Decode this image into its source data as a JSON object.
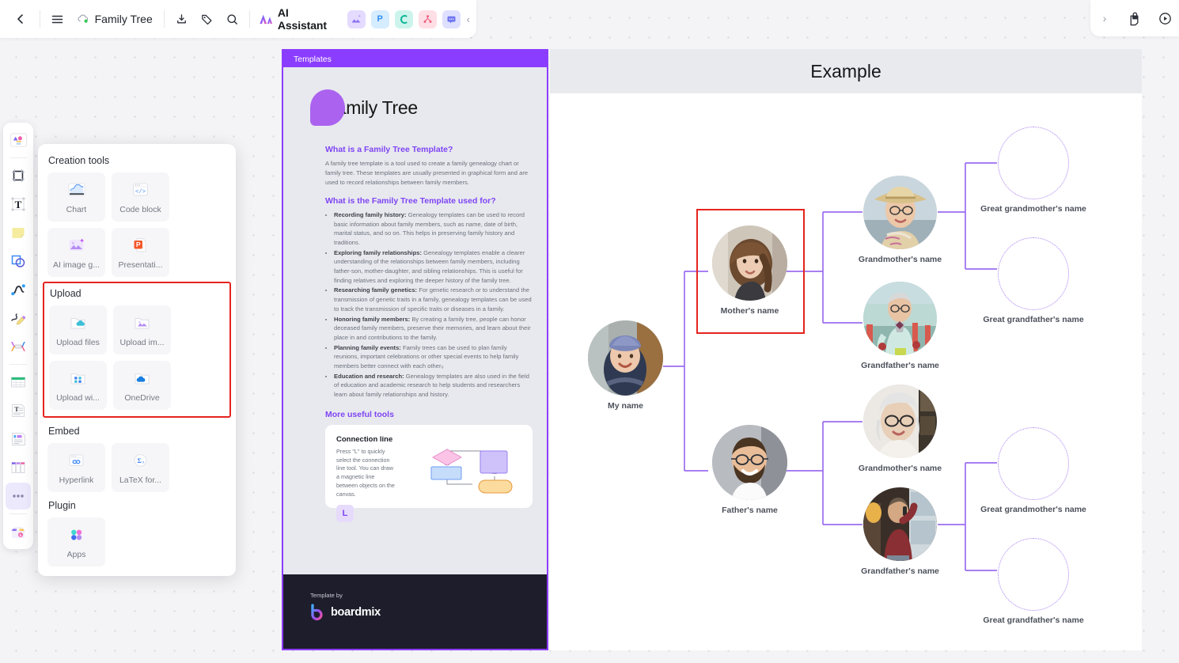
{
  "topbar": {
    "back_label": "‹",
    "menu_label": "☰",
    "doc_title": "Family Tree",
    "cloud_icon": "cloud-saved-icon",
    "download_label": "download-icon",
    "tag_label": "tag-icon",
    "search_label": "search-icon",
    "ai_assistant_label": "AI Assistant",
    "quick_tools": [
      {
        "name": "ai-image-tool",
        "glyph": "▲"
      },
      {
        "name": "presentation-tool",
        "glyph": "P"
      },
      {
        "name": "mindmap-tool",
        "glyph": "⊂"
      },
      {
        "name": "flowchart-tool",
        "glyph": "∴"
      },
      {
        "name": "comment-tool",
        "glyph": "■"
      }
    ],
    "collapse_label": "‹"
  },
  "topright": {
    "expand_label": "›",
    "share_icon": "share-lock-icon",
    "present_icon": "present-play-icon"
  },
  "left_toolbar": {
    "items": [
      {
        "name": "templates-tool",
        "title": "Templates"
      },
      {
        "name": "frame-tool",
        "title": "Frame"
      },
      {
        "name": "text-tool",
        "title": "Text"
      },
      {
        "name": "sticky-note-tool",
        "title": "Sticky note"
      },
      {
        "name": "shape-tool",
        "title": "Shape"
      },
      {
        "name": "connector-tool",
        "title": "Connection line"
      },
      {
        "name": "pen-tool",
        "title": "Pen"
      },
      {
        "name": "mindmap-tool",
        "title": "Mind map"
      },
      {
        "name": "table-tool",
        "title": "Table"
      },
      {
        "name": "document-tool",
        "title": "Document"
      },
      {
        "name": "note-card-tool",
        "title": "Note card"
      },
      {
        "name": "kanban-tool",
        "title": "Kanban"
      },
      {
        "name": "more-tools",
        "title": "More"
      },
      {
        "name": "resources-tool",
        "title": "Resources"
      }
    ]
  },
  "creation_panel": {
    "sections": [
      {
        "title": "Creation tools",
        "highlighted": false,
        "items": [
          {
            "label": "Chart",
            "icon": "chart-icon"
          },
          {
            "label": "Code block",
            "icon": "code-block-icon"
          },
          {
            "label": "AI image g...",
            "icon": "ai-image-icon"
          },
          {
            "label": "Presentati...",
            "icon": "presentation-icon"
          }
        ]
      },
      {
        "title": "Upload",
        "highlighted": true,
        "items": [
          {
            "label": "Upload files",
            "icon": "upload-files-icon"
          },
          {
            "label": "Upload im...",
            "icon": "upload-image-icon"
          },
          {
            "label": "Upload wi...",
            "icon": "upload-widget-icon"
          },
          {
            "label": "OneDrive",
            "icon": "onedrive-icon"
          }
        ]
      },
      {
        "title": "Embed",
        "highlighted": false,
        "items": [
          {
            "label": "Hyperlink",
            "icon": "hyperlink-icon"
          },
          {
            "label": "LaTeX for...",
            "icon": "latex-formula-icon"
          }
        ]
      },
      {
        "title": "Plugin",
        "highlighted": false,
        "items": [
          {
            "label": "Apps",
            "icon": "apps-icon"
          }
        ]
      }
    ]
  },
  "template_panel": {
    "header_label": "Templates",
    "title": "Family Tree",
    "h1": "What is a Family Tree Template?",
    "p1": "A family tree template is a tool used to create a family genealogy chart or family tree. These templates are usually presented in graphical form and are used to record relationships between family members.",
    "h2": "What is the Family Tree Template used for?",
    "bullets": [
      {
        "lead": "Recording family history:",
        "rest": " Genealogy templates can be used to record basic information about family members, such as name, date of birth, marital status, and so on. This helps in preserving family history and traditions."
      },
      {
        "lead": "Exploring family relationships:",
        "rest": " Genealogy templates enable a clearer understanding of the relationships between family members, including father-son, mother-daughter, and sibling relationships. This is useful for finding relatives and exploring the deeper history of the family tree."
      },
      {
        "lead": "Researching family genetics:",
        "rest": " For genetic research or to understand the transmission of genetic traits in a family, genealogy templates can be used to track the transmission of specific traits or diseases in a family."
      },
      {
        "lead": "Honoring family members:",
        "rest": " By creating a family tree, people can honor deceased family members, preserve their memories, and learn about their place in and contributions to the family."
      },
      {
        "lead": "Planning family events:",
        "rest": " Family trees can be used to plan family reunions, important celebrations or other special events to help family members better connect with each other₀"
      },
      {
        "lead": "Education and research:",
        "rest": " Genealogy templates are also used in the field of education and academic research to help students and researchers learn about family relationships and history."
      }
    ],
    "h3": "More useful tools",
    "tool_card": {
      "title": "Connection line",
      "body": "Press \"L\" to quickly select the connection line tool. You can draw a magnetic line between objects on the canvas.",
      "key": "L"
    },
    "footer_by": "Template by",
    "footer_brand": "boardmix"
  },
  "canvas": {
    "frame_title": "Example",
    "nodes": [
      {
        "id": "me",
        "label": "My name",
        "type": "photo",
        "photo": "child-in-knit-hat"
      },
      {
        "id": "mom",
        "label": "Mother's name",
        "type": "photo",
        "photo": "young-woman-curly-hair",
        "selected": true
      },
      {
        "id": "dad",
        "label": "Father's name",
        "type": "photo",
        "photo": "bearded-man-glasses"
      },
      {
        "id": "mgm",
        "label": "Grandmother's name",
        "type": "photo",
        "photo": "woman-sun-hat"
      },
      {
        "id": "mgf",
        "label": "Grandfather's name",
        "type": "photo",
        "photo": "older-man-mint-coat"
      },
      {
        "id": "pgm",
        "label": "Grandmother's name",
        "type": "photo",
        "photo": "white-haired-woman-glasses"
      },
      {
        "id": "pgf",
        "label": "Grandfather's name",
        "type": "photo",
        "photo": "man-on-phone-library"
      },
      {
        "id": "ggm1",
        "label": "Great grandmother's name",
        "type": "ghost"
      },
      {
        "id": "ggf1",
        "label": "Great grandfather's name",
        "type": "ghost"
      },
      {
        "id": "ggm2",
        "label": "Great grandmother's name",
        "type": "ghost"
      },
      {
        "id": "ggf2",
        "label": "Great grandfather's name",
        "type": "ghost"
      }
    ]
  },
  "colors": {
    "brand_purple": "#8b3dff",
    "connector_purple": "#9b6df0",
    "selection_red": "#e5241f",
    "canvas_bg": "#f4f4f6",
    "frame_header": "#e8eaee"
  }
}
